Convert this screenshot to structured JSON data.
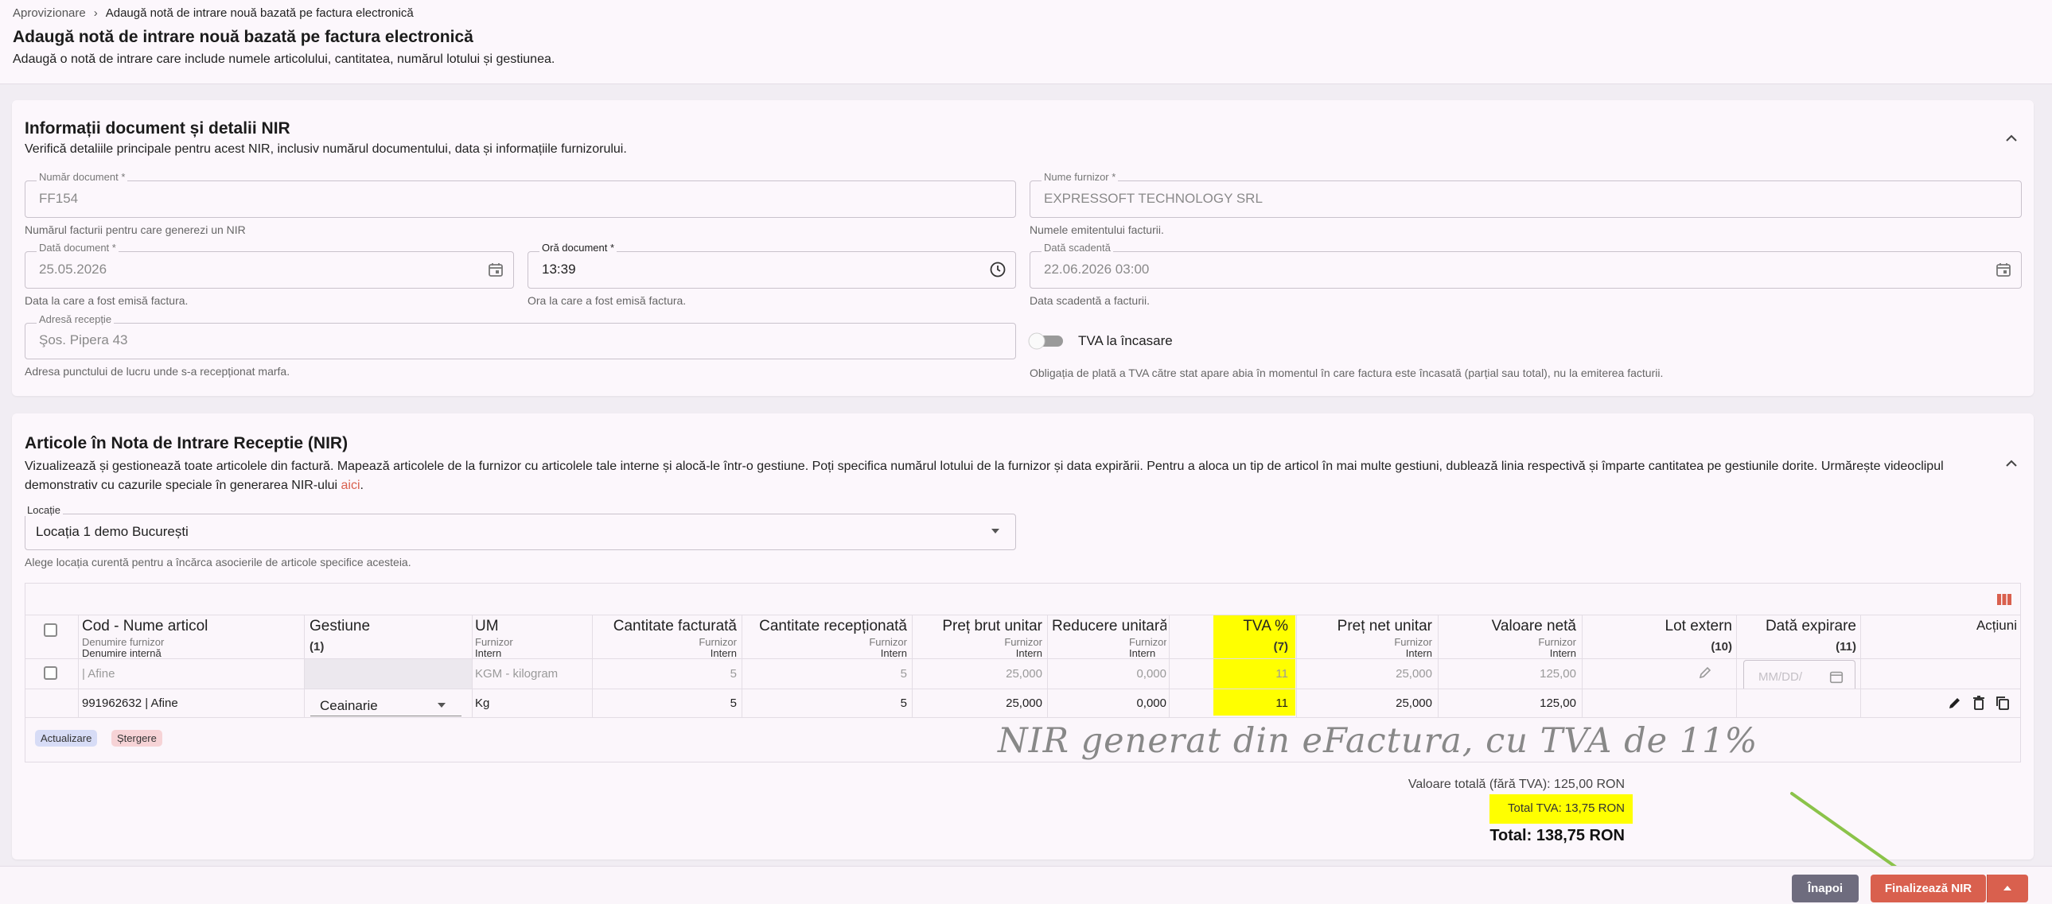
{
  "breadcrumb": {
    "parent": "Aprovizionare",
    "separator": "›",
    "current": "Adaugă notă de intrare nouă bazată pe factura electronică"
  },
  "page": {
    "title": "Adaugă notă de intrare nouă bazată pe factura electronică",
    "subtitle": "Adaugă o notă de intrare care include numele articolului, cantitatea, numărul lotului și gestiunea."
  },
  "doc_section": {
    "title": "Informații document și detalii NIR",
    "description": "Verifică detaliile principale pentru acest NIR, inclusiv numărul documentului, data și informațiile furnizorului.",
    "fields": {
      "doc_number": {
        "label": "Număr document *",
        "value": "FF154",
        "help": "Numărul facturii pentru care generezi un NIR"
      },
      "supplier": {
        "label": "Nume furnizor *",
        "value": "EXPRESSOFT TECHNOLOGY SRL",
        "help": "Numele emitentului facturii."
      },
      "doc_date": {
        "label": "Dată document *",
        "value": "25.05.2026",
        "help": "Data la care a fost emisă factura."
      },
      "doc_time": {
        "label": "Oră document *",
        "value": "13:39",
        "help": "Ora la care a fost emisă factura."
      },
      "due_date": {
        "label": "Dată scadentă",
        "value": "22.06.2026 03:00",
        "help": "Data scadentă a facturii."
      },
      "address": {
        "label": "Adresă recepție",
        "value": "Şos. Pipera 43",
        "help": "Adresa punctului de lucru unde s-a recepționat marfa."
      },
      "vat_toggle": {
        "label": "TVA la încasare",
        "help": "Obligația de plată a TVA către stat apare abia în momentul în care factura este încasată (parțial sau total), nu la emiterea facturii."
      }
    }
  },
  "items_section": {
    "title": "Articole în Nota de Intrare Receptie (NIR)",
    "description": "Vizualizează și gestionează toate articolele din factură. Mapează articolele de la furnizor cu articolele tale interne și alocă-le într-o gestiune. Poți specifica numărul lotului de la furnizor și data expirării. Pentru a aloca un tip de articol în mai multe gestiuni, dublează linia respectivă și împarte cantitatea pe gestiunile dorite. Urmărește videoclipul demonstrativ cu cazurile speciale în generarea NIR-ului",
    "link_text": "aici",
    "location": {
      "label": "Locație",
      "value": "Locația 1 demo București",
      "help": "Alege locația curentă pentru a încărca asocierile de articole specifice acesteia."
    }
  },
  "table": {
    "columns": [
      {
        "title": "Cod - Nume articol",
        "sub1": "Denumire furnizor",
        "sub2": "Denumire internă"
      },
      {
        "title": "Gestiune",
        "sub1": "(1)",
        "sub2": ""
      },
      {
        "title": "UM",
        "sub1": "Furnizor",
        "sub2": "Intern"
      },
      {
        "title": "Cantitate facturată",
        "sub1": "Furnizor",
        "sub2": "Intern"
      },
      {
        "title": "Cantitate recepționată",
        "sub1": "Furnizor",
        "sub2": "Intern"
      },
      {
        "title": "Preț brut unitar",
        "sub1": "Furnizor",
        "sub2": "Intern"
      },
      {
        "title": "Reducere unitară",
        "sub1": "Furnizor",
        "sub2": "Intern"
      },
      {
        "title": "TVA %",
        "sub1": "(7)",
        "sub2": ""
      },
      {
        "title": "Preț net unitar",
        "sub1": "Furnizor",
        "sub2": "Intern"
      },
      {
        "title": "Valoare netă",
        "sub1": "Furnizor",
        "sub2": "Intern"
      },
      {
        "title": "Lot extern",
        "sub1": "(10)",
        "sub2": ""
      },
      {
        "title": "Dată expirare",
        "sub1": "(11)",
        "sub2": ""
      },
      {
        "title": "Acțiuni",
        "sub1": "",
        "sub2": ""
      }
    ],
    "supplier_row": {
      "name": "| Afine",
      "um": "KGM - kilogram",
      "qty_inv": "5",
      "qty_rec": "5",
      "gross": "25,000",
      "discount": "0,000",
      "vat": "11",
      "net": "25,000",
      "value": "125,00",
      "expiry_placeholder": "MM/DD/"
    },
    "internal_row": {
      "name": "991962632 | Afine",
      "gestiune": "Ceainarie",
      "um": "Kg",
      "qty_inv": "5",
      "qty_rec": "5",
      "gross": "25,000",
      "discount": "0,000",
      "vat": "11",
      "net": "25,000",
      "value": "125,00"
    },
    "legend": {
      "update": "Actualizare",
      "delete": "Ștergere"
    }
  },
  "annotation": "NIR generat din eFactura, cu TVA de 11%",
  "totals": {
    "net": "Valoare totală (fără TVA): 125,00 RON",
    "vat": "Total TVA: 13,75 RON",
    "total": "Total: 138,75 RON"
  },
  "footer": {
    "back": "Înapoi",
    "finalize": "Finalizează NIR"
  },
  "colors": {
    "highlight": "#ffff00",
    "primary_button": "#d9604e",
    "back_button": "#6e6c7e",
    "arrow": "#8bc34a"
  }
}
